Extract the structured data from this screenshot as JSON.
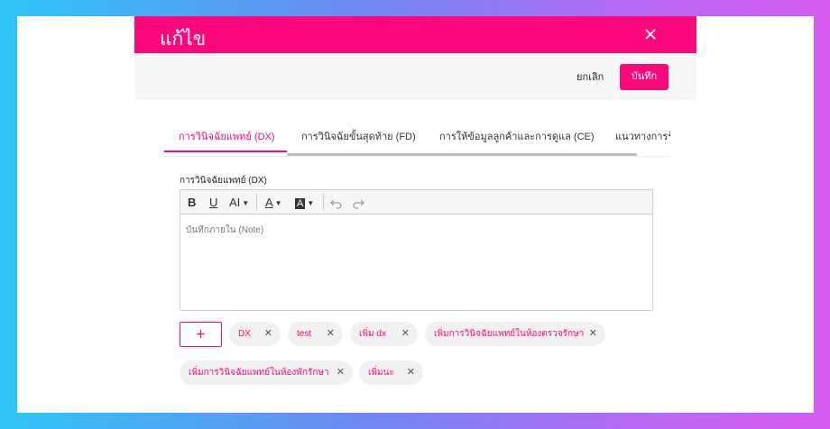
{
  "modal": {
    "title": "แก้ไข",
    "cancel_label": "ยกเลิก",
    "save_label": "บันทึก"
  },
  "tabs": [
    {
      "label": "การวินิจฉัยแพทย์ (DX)",
      "active": true
    },
    {
      "label": "การวินิจฉัยขั้นสุดท้าย (FD)",
      "active": false
    },
    {
      "label": "การให้ข้อมูลลูกค้าและการดูแล (CE)",
      "active": false
    },
    {
      "label": "แนวทางการรั",
      "active": false
    }
  ],
  "field": {
    "label": "การวินิจฉัยแพทย์ (DX)",
    "placeholder": "บันทึกภายใน (Note)"
  },
  "editor_toolbar": {
    "bold": "B",
    "underline": "U",
    "font_size": "AI",
    "text_color": "A",
    "highlight": "A"
  },
  "add_tag_label": "+",
  "tags": [
    {
      "label": "DX"
    },
    {
      "label": "test"
    },
    {
      "label": "เพิ่ม dx"
    },
    {
      "label": "เพิ่มการวินิจฉัยแพทย์ในห้องตรวจรักษา"
    },
    {
      "label": "เพิ่มการวินิจฉัยแพทย์ในห้องพักรักษา"
    },
    {
      "label": "เพิ่มนะ"
    }
  ],
  "colors": {
    "accent": "#fb087c"
  }
}
